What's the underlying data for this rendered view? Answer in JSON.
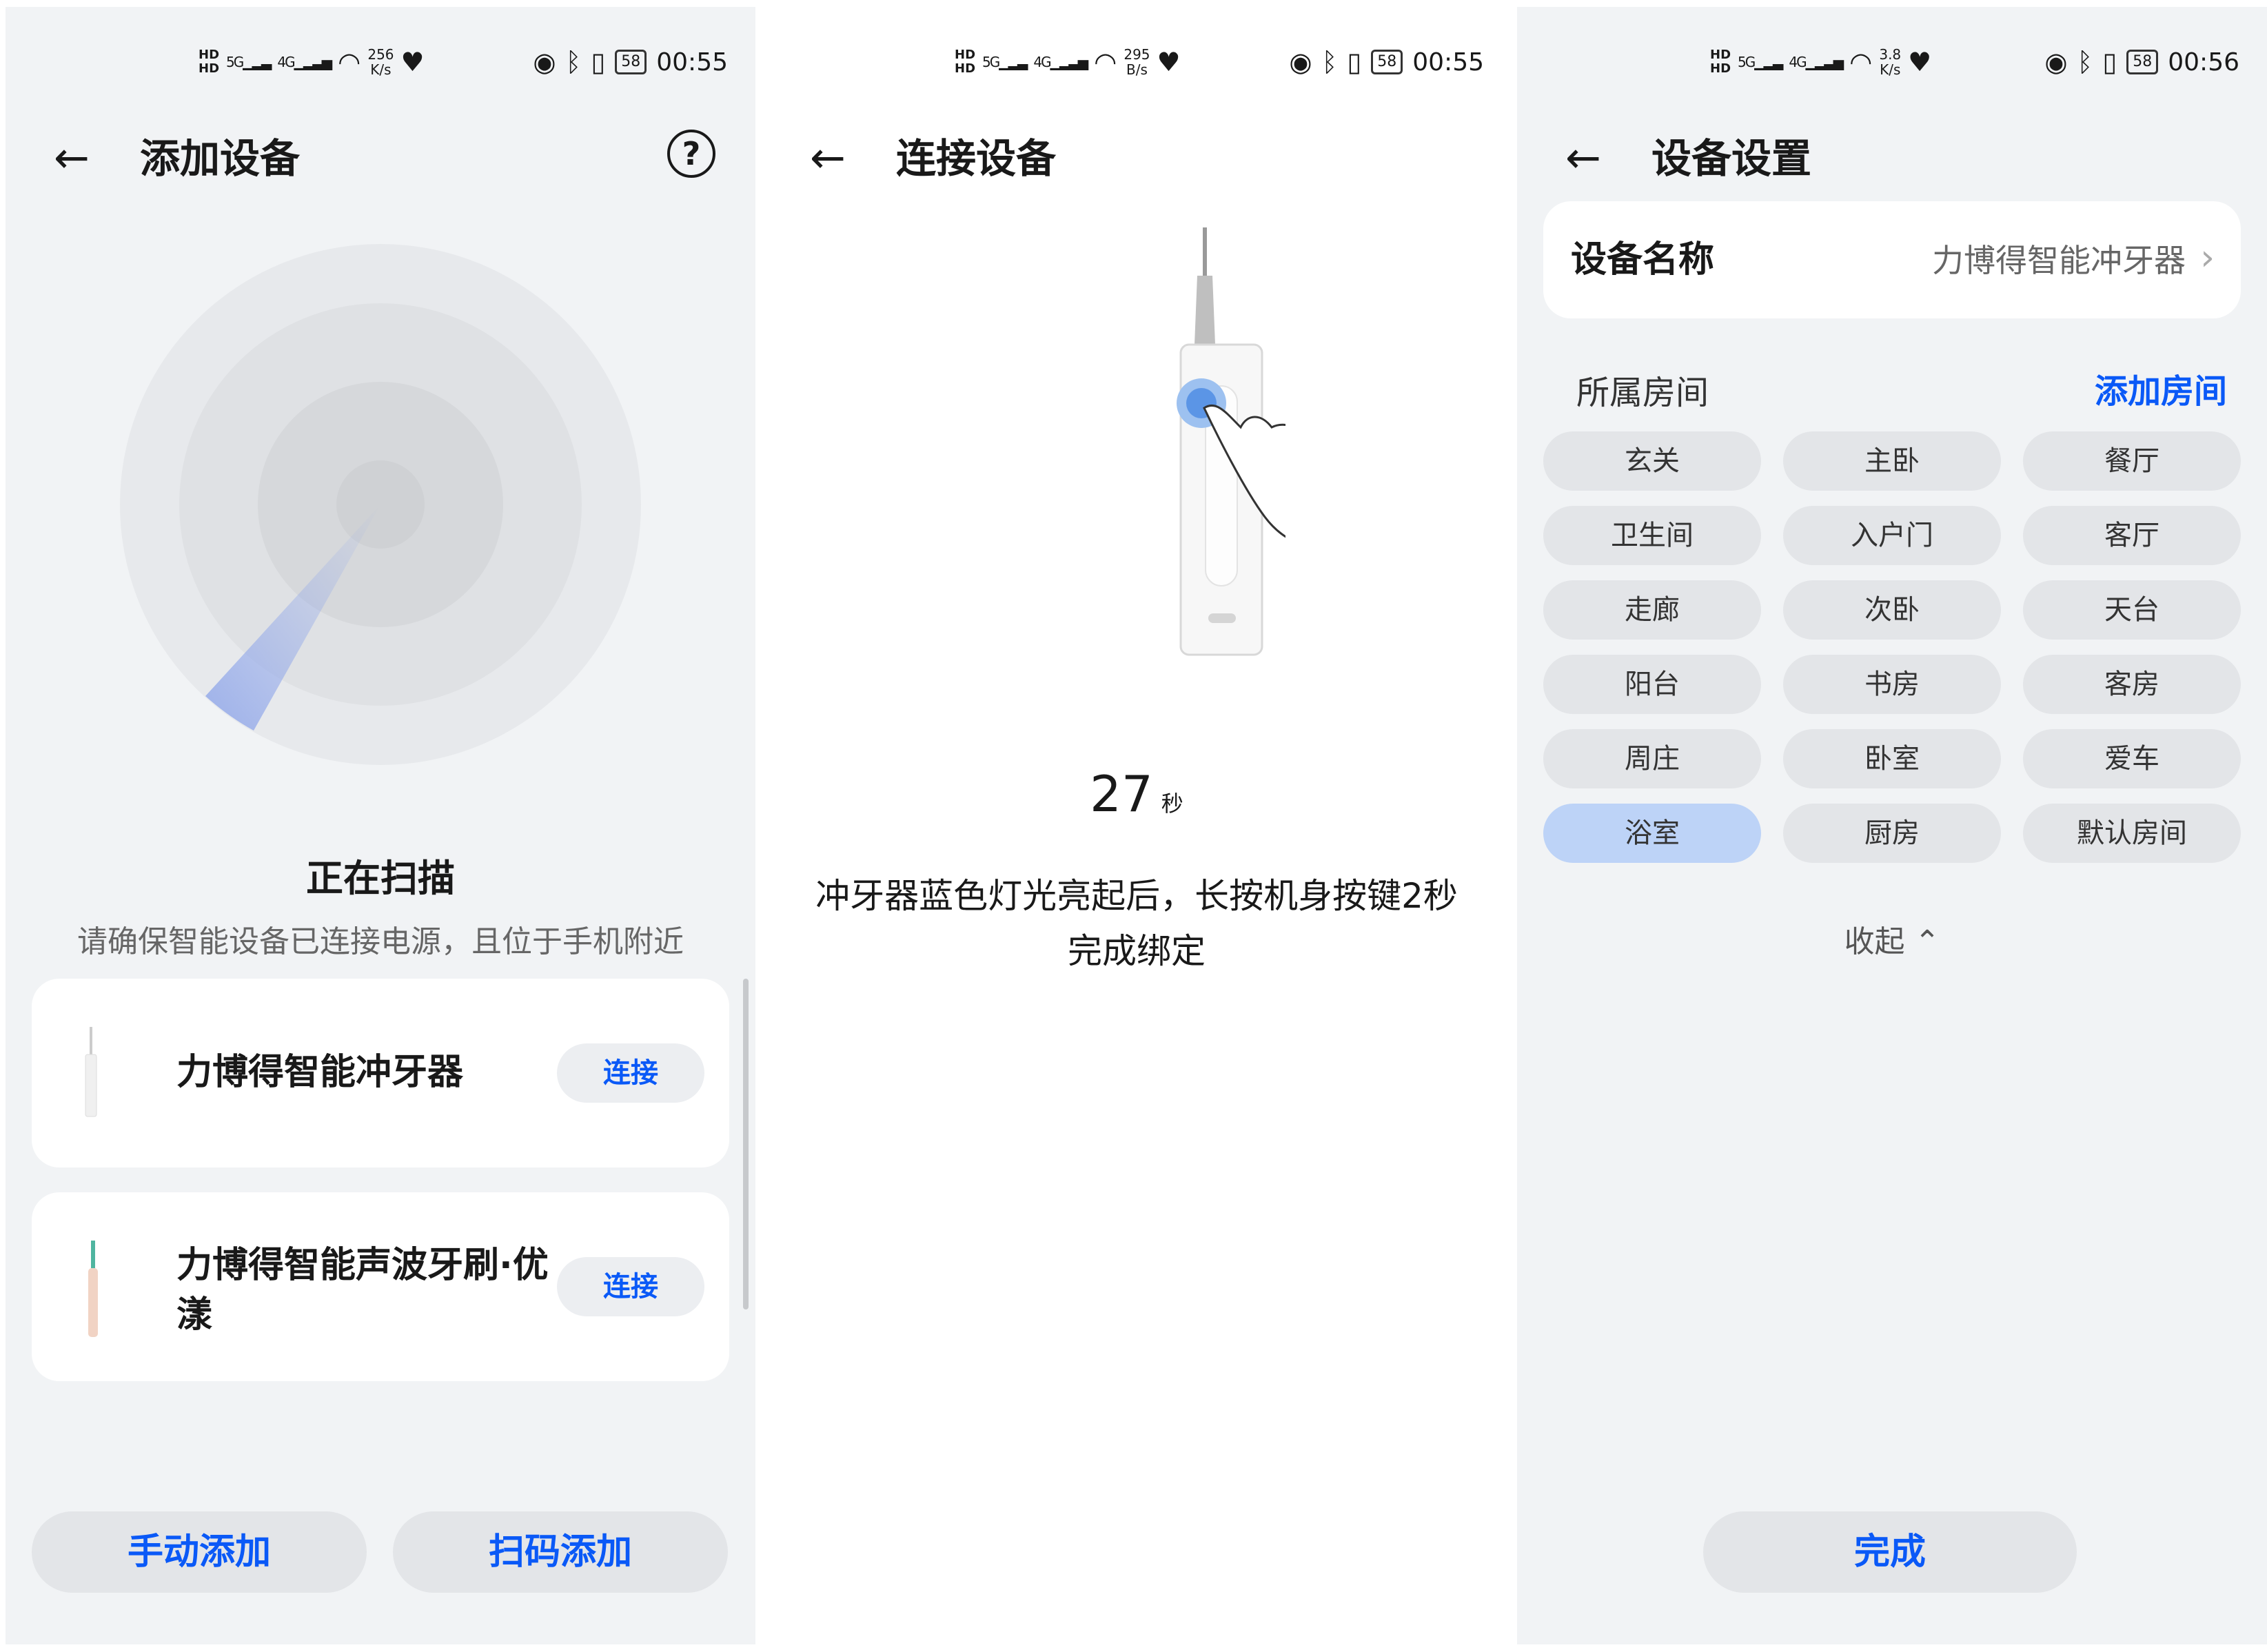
{
  "screens": [
    {
      "status": {
        "net1": "HD",
        "net2": "HD",
        "sig5g": "5G",
        "sig4g": "4G",
        "speed_val": "256",
        "speed_unit": "K/s",
        "battery": "58",
        "time": "00:55"
      },
      "title": "添加设备",
      "help_icon": "help-circle-icon",
      "scan_title": "正在扫描",
      "scan_desc": "请确保智能设备已连接电源，且位于手机附近",
      "devices": [
        {
          "name": "力博得智能冲牙器",
          "action": "连接"
        },
        {
          "name": "力博得智能声波牙刷·优漾",
          "action": "连接"
        }
      ],
      "manual_add": "手动添加",
      "scan_add": "扫码添加"
    },
    {
      "status": {
        "net1": "HD",
        "net2": "HD",
        "sig5g": "5G",
        "sig4g": "4G",
        "speed_val": "295",
        "speed_unit": "B/s",
        "battery": "58",
        "time": "00:55"
      },
      "title": "连接设备",
      "countdown": "27",
      "countdown_unit": "秒",
      "instruction": "冲牙器蓝色灯光亮起后，长按机身按键2秒完成绑定"
    },
    {
      "status": {
        "net1": "HD",
        "net2": "HD",
        "sig5g": "5G",
        "sig4g": "4G",
        "speed_val": "3.8",
        "speed_unit": "K/s",
        "battery": "58",
        "time": "00:56"
      },
      "title": "设备设置",
      "name_label": "设备名称",
      "name_value": "力博得智能冲牙器",
      "room_label": "所属房间",
      "add_room": "添加房间",
      "rooms": [
        "玄关",
        "主卧",
        "餐厅",
        "卫生间",
        "入户门",
        "客厅",
        "走廊",
        "次卧",
        "天台",
        "阳台",
        "书房",
        "客房",
        "周庄",
        "卧室",
        "爱车",
        "浴室",
        "厨房",
        "默认房间"
      ],
      "selected_room": "浴室",
      "collapse": "收起",
      "done": "完成"
    }
  ],
  "colors": {
    "accent": "#0a59f7",
    "page_bg": "#f1f3f5",
    "chip_bg": "#e3e5e8",
    "chip_selected": "#bdd3f7"
  }
}
